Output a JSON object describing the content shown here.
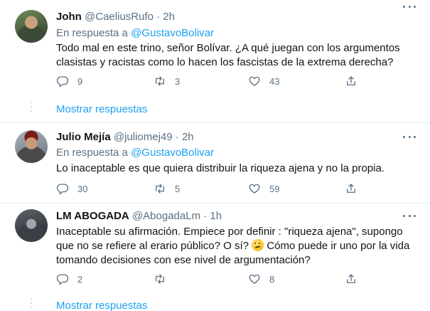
{
  "colors": {
    "accent": "#1da1f2",
    "secondary_text": "#5b7083",
    "primary_text": "#0f1419"
  },
  "tweets": [
    {
      "name": "John",
      "handle": "@CaeliusRufo",
      "dot": "·",
      "time": "2h",
      "reply_prefix": "En respuesta a",
      "reply_to": "@GustavoBolivar",
      "text_lines": [
        "Todo mal en este trino, señor Bolívar. ¿A qué juegan con los argumentos",
        "clasistas y racistas como lo hacen los fascistas de la extrema derecha?"
      ],
      "replies": "9",
      "retweets": "3",
      "likes": "43",
      "show_replies": "Mostrar respuestas"
    },
    {
      "name": "Julio Mejía",
      "handle": "@juliomej49",
      "dot": "·",
      "time": "2h",
      "reply_prefix": "En respuesta a",
      "reply_to": "@GustavoBolivar",
      "text_lines": [
        "Lo inaceptable es que quiera distribuir la riqueza ajena y no la propia."
      ],
      "replies": "30",
      "retweets": "5",
      "likes": "59"
    },
    {
      "name": "LM ABOGADA",
      "handle": "@AbogadaLm",
      "dot": "·",
      "time": "1h",
      "text_lines": [
        "Inaceptable su afirmación. Empiece por definir : \"riqueza ajena\", supongo",
        "que no se refiere al erario público? O sí?",
        "Cómo puede ir uno por la vida",
        "tomando decisiones con ese nivel de argumentación?"
      ],
      "emoji_name": "thinking-face-emoji",
      "replies": "2",
      "retweets": "",
      "likes": "8",
      "show_replies": "Mostrar respuestas"
    }
  ],
  "icons": [
    "reply-icon",
    "retweet-icon",
    "like-icon",
    "share-icon",
    "more-icon"
  ]
}
